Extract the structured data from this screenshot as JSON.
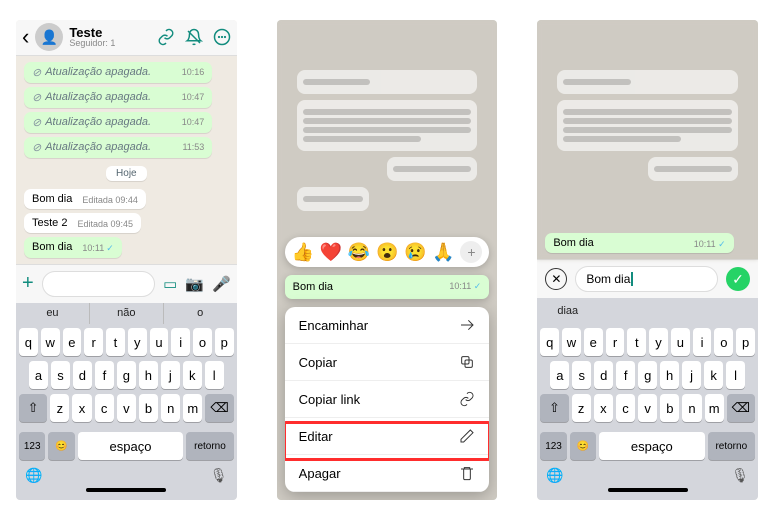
{
  "phone1": {
    "header": {
      "title": "Teste",
      "subtitle": "Seguidor: 1"
    },
    "deleted_label": "Atualização apagada.",
    "deleted_times": [
      "10:16",
      "10:47",
      "10:47",
      "11:53"
    ],
    "date_pill": "Hoje",
    "msgs": [
      {
        "text": "Bom dia",
        "meta": "Editada 09:44",
        "type": "in"
      },
      {
        "text": "Teste 2",
        "meta": "Editada 09:45",
        "type": "in"
      },
      {
        "text": "Bom dia",
        "meta": "10:11",
        "type": "out",
        "check": true
      }
    ],
    "suggestions": [
      "eu",
      "não",
      "o"
    ]
  },
  "phone2": {
    "reactions": [
      "👍",
      "❤️",
      "😂",
      "😮",
      "😢",
      "🙏"
    ],
    "selected": {
      "text": "Bom dia",
      "time": "10:11"
    },
    "menu": [
      {
        "label": "Encaminhar",
        "icon": "forward"
      },
      {
        "label": "Copiar",
        "icon": "copy"
      },
      {
        "label": "Copiar link",
        "icon": "link"
      },
      {
        "label": "Editar",
        "icon": "pencil",
        "highlight": true
      },
      {
        "label": "Apagar",
        "icon": "trash",
        "danger": true
      }
    ]
  },
  "phone3": {
    "bubble": {
      "text": "Bom dia",
      "time": "10:11"
    },
    "edit_value": "Bom dia",
    "suggestion": "diaa"
  },
  "keyboard": {
    "r1": [
      "q",
      "w",
      "e",
      "r",
      "t",
      "y",
      "u",
      "i",
      "o",
      "p"
    ],
    "r2": [
      "a",
      "s",
      "d",
      "f",
      "g",
      "h",
      "j",
      "k",
      "l"
    ],
    "r3": [
      "z",
      "x",
      "c",
      "v",
      "b",
      "n",
      "m"
    ],
    "num": "123",
    "space": "espaço",
    "return": "retorno"
  }
}
